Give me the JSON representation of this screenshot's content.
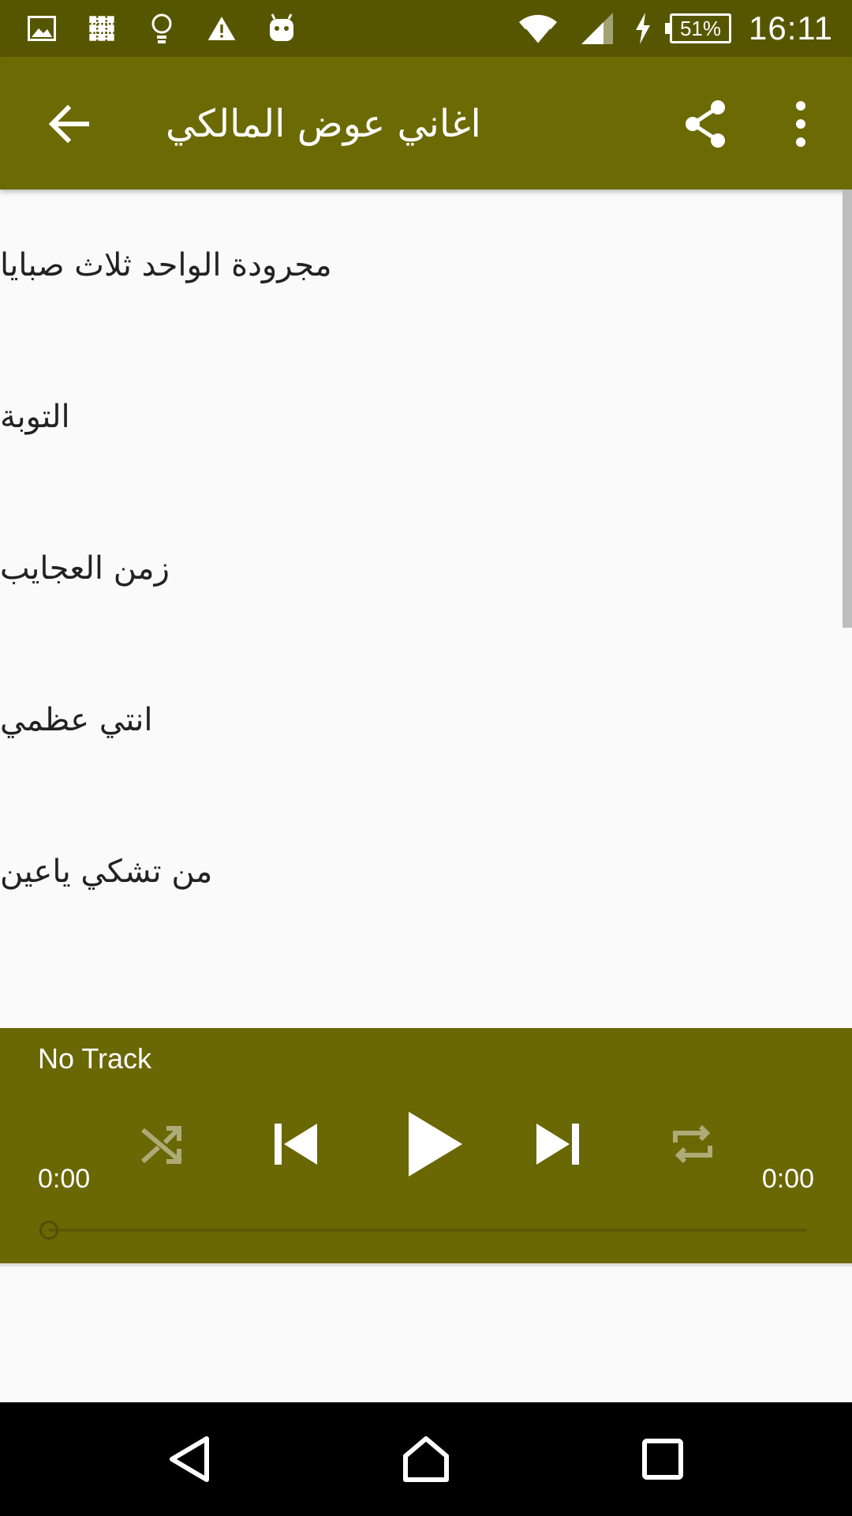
{
  "status_bar": {
    "time": "16:11",
    "battery": "51%",
    "icons_left": [
      "image-icon",
      "app-notification-icon",
      "lightbulb-icon",
      "warning-icon",
      "android-icon"
    ],
    "icons_right": [
      "wifi-icon",
      "signal-icon",
      "charging-icon",
      "battery-icon"
    ]
  },
  "app_bar": {
    "title": "اغاني عوض المالكي",
    "icons": [
      "back-arrow-icon",
      "share-icon",
      "more-vert-icon"
    ]
  },
  "songs": [
    "مجرودة الواحد ثلاث صبايا",
    "التوبة",
    "زمن العجايب",
    "انتي عظمي",
    "من تشكي ياعين"
  ],
  "player": {
    "track_title": "No Track",
    "current_time": "0:00",
    "total_time": "0:00",
    "progress": 0,
    "controls": [
      "shuffle-icon",
      "skip-previous-icon",
      "play-icon",
      "skip-next-icon",
      "repeat-icon"
    ]
  },
  "nav_bar": {
    "icons": [
      "nav-back-icon",
      "nav-home-icon",
      "nav-recents-icon"
    ]
  },
  "colors": {
    "status_bar": "#575600",
    "app_bar": "#6c6a05",
    "player": "#6a6705",
    "background": "#fafafa",
    "text": "#222222"
  }
}
